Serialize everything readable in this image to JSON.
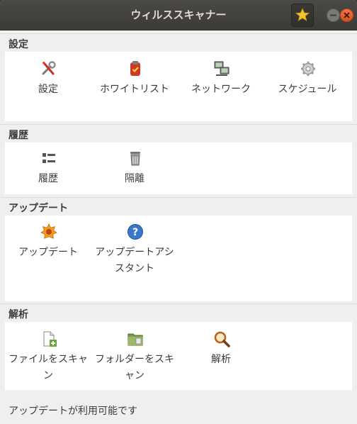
{
  "window": {
    "title": "ウィルススキャナー"
  },
  "titlebar": {
    "favorite_icon": "star-icon",
    "minimize_icon": "minimize-icon",
    "close_icon": "close-icon"
  },
  "sections": [
    {
      "heading": "設定",
      "items": [
        {
          "label": "設定",
          "icon": "tools-icon"
        },
        {
          "label": "ホワイトリスト",
          "icon": "whitelist-icon"
        },
        {
          "label": "ネットワーク",
          "icon": "network-icon"
        },
        {
          "label": "スケジュール",
          "icon": "gear-icon"
        }
      ]
    },
    {
      "heading": "履歴",
      "items": [
        {
          "label": "履歴",
          "icon": "history-list-icon"
        },
        {
          "label": "隔離",
          "icon": "quarantine-trash-icon"
        }
      ]
    },
    {
      "heading": "アップデート",
      "items": [
        {
          "label": "アップデート",
          "icon": "update-burst-icon"
        },
        {
          "label": "アップデートアシスタント",
          "icon": "help-question-icon"
        }
      ]
    },
    {
      "heading": "解析",
      "items": [
        {
          "label": "ファイルをスキャン",
          "icon": "file-add-icon"
        },
        {
          "label": "フォルダーをスキャン",
          "icon": "folder-icon"
        },
        {
          "label": "解析",
          "icon": "magnifier-icon"
        }
      ]
    }
  ],
  "status": {
    "text": "アップデートが利用可能です"
  }
}
